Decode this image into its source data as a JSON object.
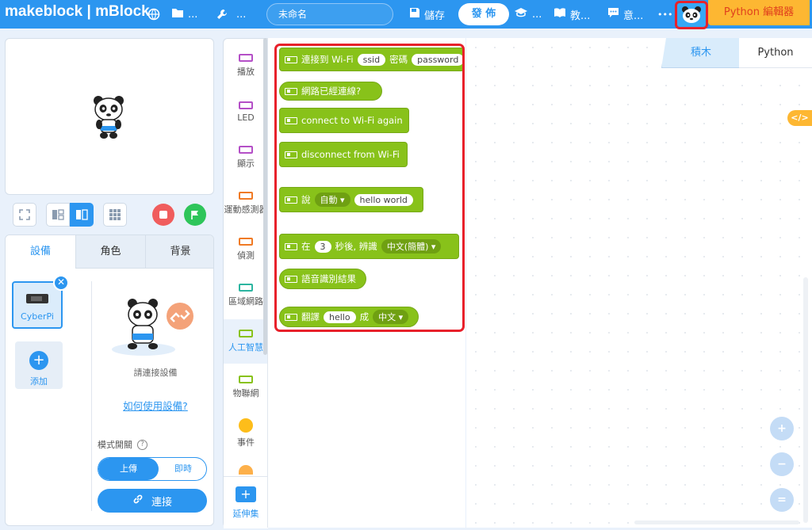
{
  "topbar": {
    "logo": "makeblock | mBlock",
    "project_name": "未命名",
    "save": "儲存",
    "publish": "發 佈",
    "more_a": "...",
    "tutorials": "教...",
    "feedback": "意...",
    "more": "•••",
    "python_editor": "Python 編輯器"
  },
  "stage_controls": {},
  "device_panel": {
    "tabs": [
      "設備",
      "角色",
      "背景"
    ],
    "device_name": "CyberPi",
    "add_label": "添加",
    "connect_prompt": "請連接設備",
    "how_to_link": "如何使用設備?",
    "mode_label": "模式開關",
    "mode_upload": "上傳",
    "mode_live": "即時",
    "connect_button": "連接"
  },
  "categories": [
    {
      "label": "播放",
      "color": "#b44fc7"
    },
    {
      "label": "LED",
      "color": "#b44fc7"
    },
    {
      "label": "顯示",
      "color": "#b44fc7"
    },
    {
      "label": "運動感測器",
      "color": "#f07a24"
    },
    {
      "label": "偵測",
      "color": "#f07a24"
    },
    {
      "label": "區域網路",
      "color": "#2cb5a0"
    },
    {
      "label": "人工智慧",
      "color": "#88c21a"
    },
    {
      "label": "物聯網",
      "color": "#88c21a"
    },
    {
      "label": "事件",
      "color": "#fdbd1a"
    }
  ],
  "extensions_label": "延伸集",
  "blocks": {
    "wifi_connect": {
      "text1": "連接到 Wi-Fi",
      "ssid": "ssid",
      "text2": "密碼",
      "password": "password"
    },
    "network_connected": "網路已經連線?",
    "reconnect": "connect to Wi-Fi again",
    "disconnect": "disconnect from Wi-Fi",
    "say": {
      "text1": "說",
      "lang": "自動",
      "message": "hello world"
    },
    "recognize": {
      "text1": "在",
      "seconds": "3",
      "text2": "秒後, 辨識",
      "lang": "中文(簡體)"
    },
    "speech_result": "語音識別結果",
    "translate": {
      "text1": "翻譯",
      "word": "hello",
      "text2": "成",
      "lang": "中文"
    }
  },
  "workspace_tabs": {
    "blocks": "積木",
    "python": "Python"
  },
  "code_toggle": "</>",
  "zoom": {
    "in": "+",
    "out": "−",
    "reset": "="
  }
}
